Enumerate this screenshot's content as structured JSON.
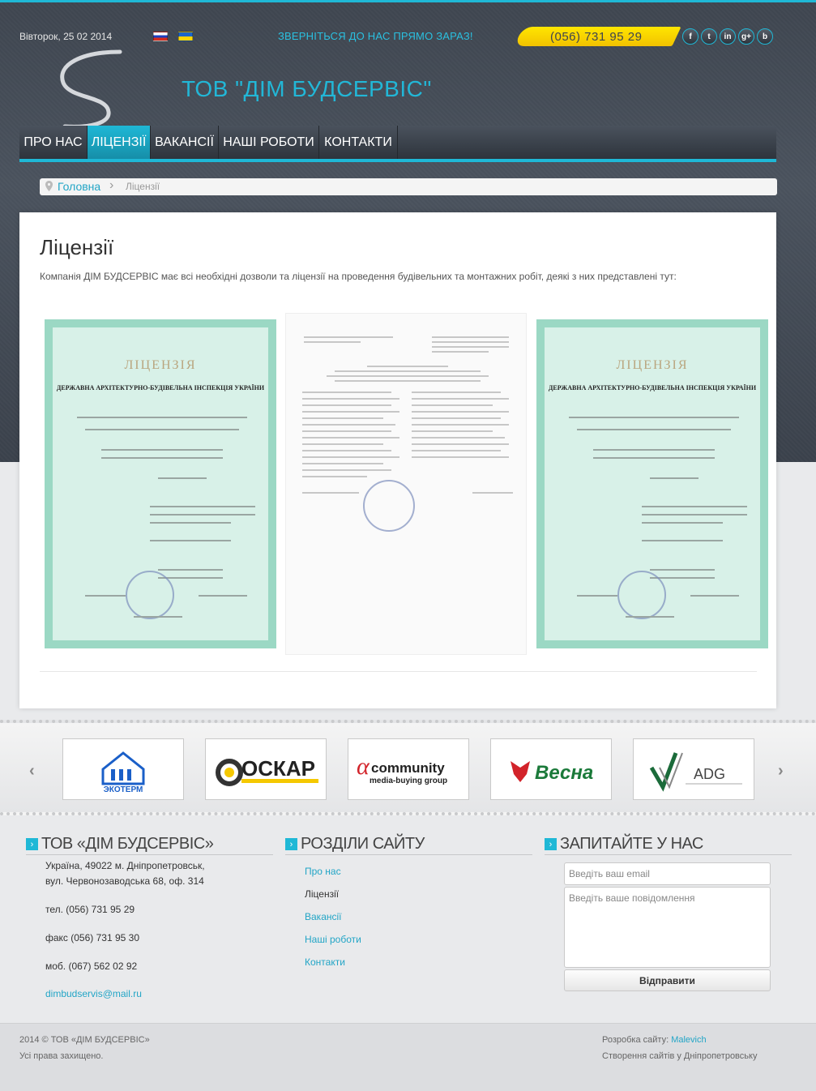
{
  "topbar": {
    "date": "Вівторок, 25 02 2014",
    "cta": "ЗВЕРНІТЬСЯ ДО НАС ПРЯМО ЗАРАЗ!",
    "phone": "(056) 731 95 29",
    "social": [
      "f",
      "t",
      "in",
      "g+",
      "b"
    ]
  },
  "brand": {
    "name": "ТОВ \"ДІМ БУДСЕРВІС\""
  },
  "nav": {
    "items": [
      "ПРО НАС",
      "ЛІЦЕНЗІЇ",
      "ВАКАНСІЇ",
      "НАШІ РОБОТИ",
      "КОНТАКТИ"
    ],
    "active": 1
  },
  "breadcrumb": {
    "home": "Головна",
    "current": "Ліцензії"
  },
  "content": {
    "title": "Ліцензії",
    "intro": "Компанія ДІМ БУДСЕРВІС має всі необхідні дозволи та ліцензії на проведення будівельних та монтажних робіт, деякі з них представлені тут:",
    "license_header": "ЛІЦЕНЗІЯ",
    "license_sub": "ДЕРЖАВНА АРХІТЕКТУРНО-БУДІВЕЛЬНА ІНСПЕКЦІЯ УКРАЇНИ"
  },
  "partners": [
    "ЭКОТЕРМ",
    "ОСКАР",
    "community",
    "Весна",
    "ADG"
  ],
  "footer": {
    "col1": {
      "title": "ТОВ «ДІМ БУДСЕРВІС»",
      "address1": "Україна, 49022 м. Дніпропетровськ,",
      "address2": "вул. Червонозаводська 68, оф. 314",
      "tel": "тел. (056) 731 95 29",
      "fax": "факс (056) 731 95 30",
      "mob": "моб. (067) 562 02 92",
      "email": "dimbudservis@mail.ru"
    },
    "col2": {
      "title": "РОЗДІЛИ САЙТУ",
      "links": [
        "Про нас",
        "Ліцензії",
        "Вакансії",
        "Наші роботи",
        "Контакти"
      ]
    },
    "col3": {
      "title": "ЗАПИТАЙТЕ У НАС",
      "email_placeholder": "Введіть ваш email",
      "message_placeholder": "Введіть ваше повідомлення",
      "send": "Відправити"
    }
  },
  "bottom": {
    "copyright": "2014 © ТОВ «ДІМ БУДСЕРВІС»",
    "rights": "Усі права захищено.",
    "dev_label": "Розробка сайту: ",
    "dev_name": "Malevich",
    "dev_text": "Створення сайтів у Дніпропетровську"
  },
  "colors": {
    "accent": "#1fb8d6",
    "yellow": "#ffe600",
    "header": "#3e454f"
  }
}
